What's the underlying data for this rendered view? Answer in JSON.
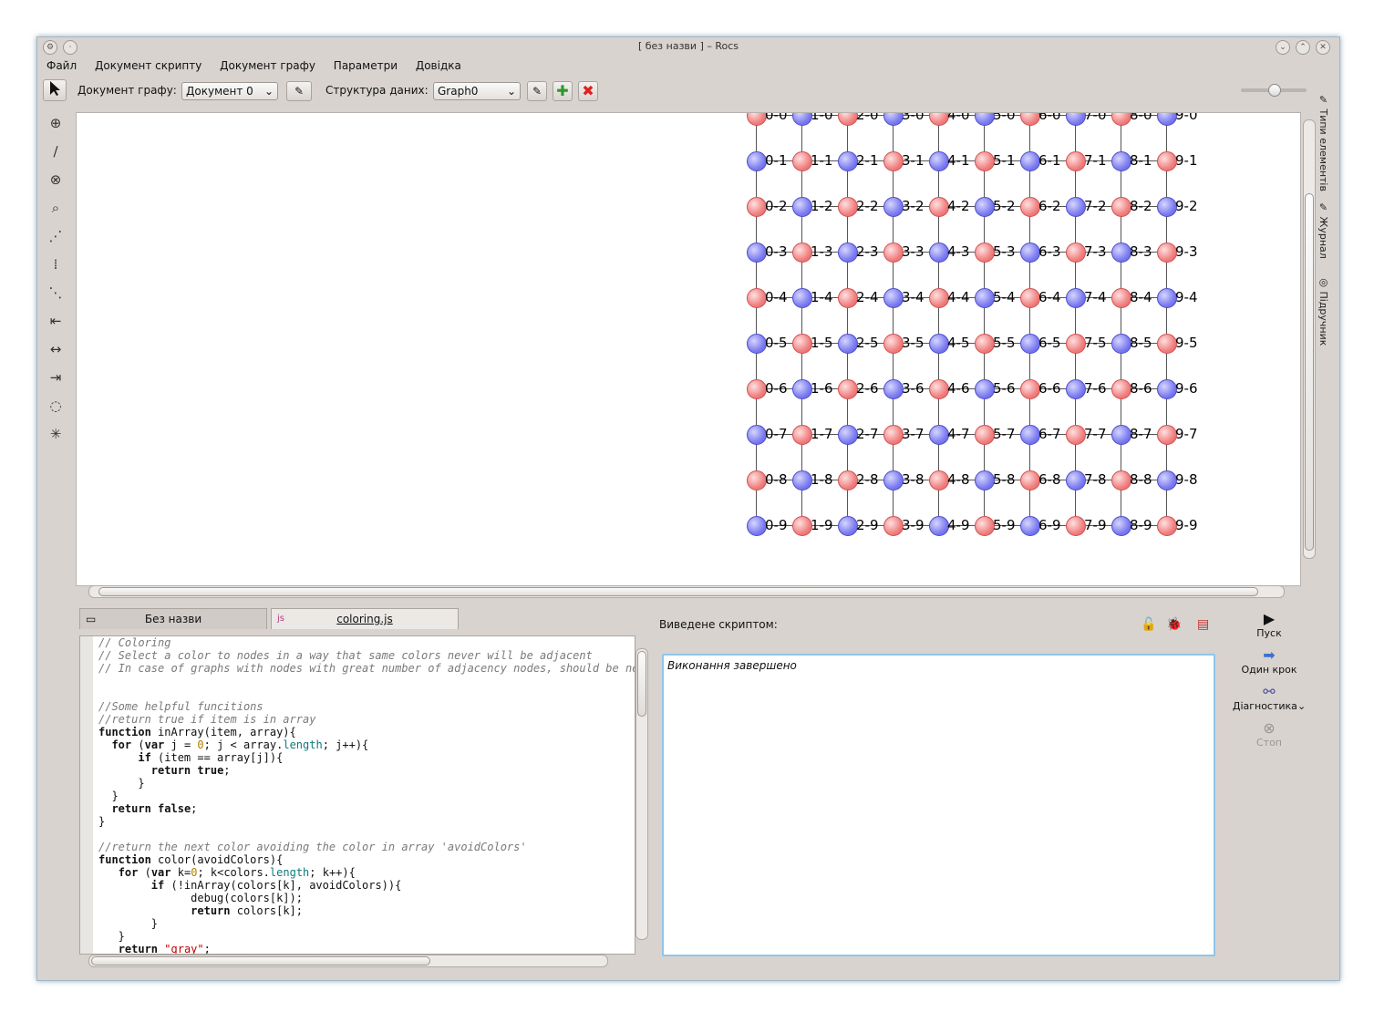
{
  "window": {
    "title": "[ без назви ] – Rocs"
  },
  "menubar": {
    "items": [
      "Файл",
      "Документ скрипту",
      "Документ графу",
      "Параметри",
      "Довідка"
    ]
  },
  "toolbar": {
    "graph_doc_label": "Документ графу:",
    "graph_doc_value": "Документ 0",
    "data_structure_label": "Структура даних:",
    "data_structure_value": "Graph0"
  },
  "right_dock": {
    "tabs": [
      "Типи елементів",
      "Журнал",
      "Підручник"
    ]
  },
  "graph": {
    "rows": 10,
    "cols": 10,
    "label_format": "col-row",
    "colors": {
      "blue": "#7c7cf0",
      "red": "#f08080"
    }
  },
  "editor": {
    "tabs": [
      {
        "label": "Без назви"
      },
      {
        "label": "coloring.js"
      }
    ],
    "lines": [
      {
        "t": "// Coloring",
        "c": "cm"
      },
      {
        "t": "// Select a color to nodes in a way that same colors never will be adjacent",
        "c": "cm"
      },
      {
        "t": "// In case of graphs with nodes with great number of adjacency nodes, should be ne",
        "c": "cm"
      },
      {
        "t": "",
        "c": ""
      },
      {
        "t": "",
        "c": ""
      },
      {
        "t": "//Some helpful funcitions",
        "c": "cm"
      },
      {
        "t": "//return true if item is in array",
        "c": "cm"
      },
      {
        "t": "function inArray(item, array){",
        "c": "code"
      },
      {
        "t": "  for (var j = 0; j < array.length; j++){",
        "c": "code"
      },
      {
        "t": "      if (item == array[j]){",
        "c": "code"
      },
      {
        "t": "        return true;",
        "c": "code"
      },
      {
        "t": "      }",
        "c": "code"
      },
      {
        "t": "  }",
        "c": "code"
      },
      {
        "t": "  return false;",
        "c": "code"
      },
      {
        "t": "}",
        "c": "code"
      },
      {
        "t": "",
        "c": ""
      },
      {
        "t": "//return the next color avoiding the color in array 'avoidColors'",
        "c": "cm"
      },
      {
        "t": "function color(avoidColors){",
        "c": "code"
      },
      {
        "t": "   for (var k=0; k<colors.length; k++){",
        "c": "code"
      },
      {
        "t": "        if (!inArray(colors[k], avoidColors)){",
        "c": "code"
      },
      {
        "t": "              debug(colors[k]);",
        "c": "code"
      },
      {
        "t": "              return colors[k];",
        "c": "code"
      },
      {
        "t": "        }",
        "c": "code"
      },
      {
        "t": "   }",
        "c": "code"
      },
      {
        "t": "   return \"gray\";",
        "c": "code"
      }
    ]
  },
  "output": {
    "label": "Виведене скриптом:",
    "text": "Виконання завершено"
  },
  "run_panel": {
    "run": "Пуск",
    "step": "Один крок",
    "debug": "Діагностика",
    "stop": "Стоп"
  }
}
